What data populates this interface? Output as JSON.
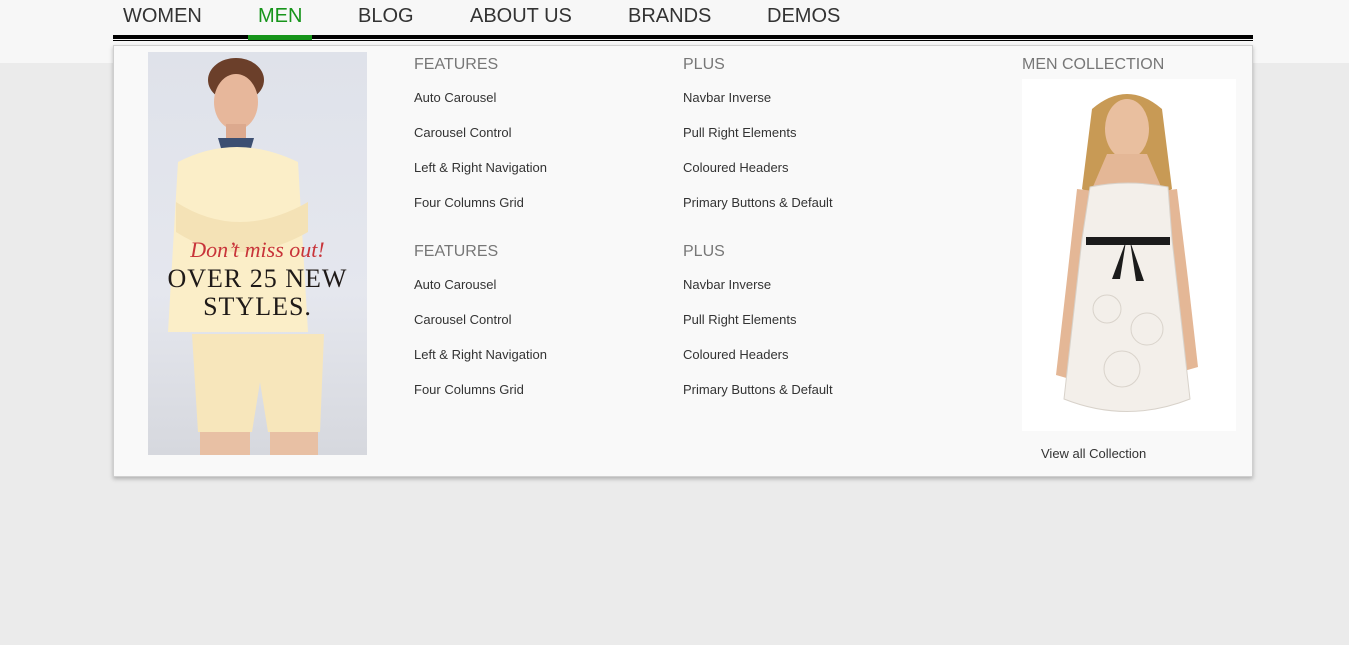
{
  "nav": {
    "items": [
      {
        "label": "WOMEN"
      },
      {
        "label": "MEN"
      },
      {
        "label": "BLOG"
      },
      {
        "label": "ABOUT US"
      },
      {
        "label": "BRANDS"
      },
      {
        "label": "DEMOS"
      }
    ],
    "active": "MEN",
    "accent_color": "#17951b"
  },
  "dropdown": {
    "promo": {
      "line1": "Don’t miss out!",
      "line2": "OVER 25 NEW",
      "line3": "STYLES."
    },
    "columns": [
      {
        "groups": [
          {
            "title": "FEATURES",
            "links": [
              "Auto Carousel",
              "Carousel Control",
              "Left & Right Navigation",
              "Four Columns Grid"
            ]
          },
          {
            "title": "FEATURES",
            "links": [
              "Auto Carousel",
              "Carousel Control",
              "Left & Right Navigation",
              "Four Columns Grid"
            ]
          }
        ]
      },
      {
        "groups": [
          {
            "title": "PLUS",
            "links": [
              "Navbar Inverse",
              "Pull Right Elements",
              "Coloured Headers",
              "Primary Buttons & Default"
            ]
          },
          {
            "title": "PLUS",
            "links": [
              "Navbar Inverse",
              "Pull Right Elements",
              "Coloured Headers",
              "Primary Buttons & Default"
            ]
          }
        ]
      }
    ],
    "collection": {
      "title": "MEN COLLECTION",
      "view_all": "View all Collection"
    }
  }
}
